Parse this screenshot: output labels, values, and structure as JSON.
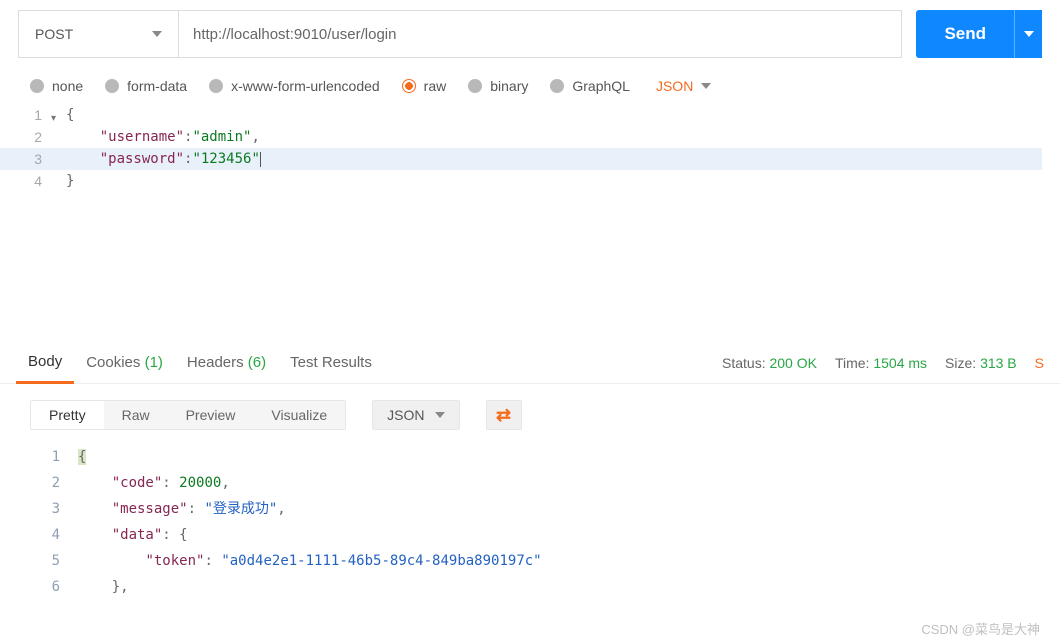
{
  "request": {
    "method": "POST",
    "url": "http://localhost:9010/user/login",
    "send_label": "Send"
  },
  "body_types": {
    "none": "none",
    "form_data": "form-data",
    "urlencoded": "x-www-form-urlencoded",
    "raw": "raw",
    "binary": "binary",
    "graphql": "GraphQL",
    "selected": "raw",
    "format": "JSON"
  },
  "request_body": {
    "lines": [
      "1",
      "2",
      "3",
      "4"
    ],
    "key_username": "\"username\"",
    "val_username": "\"admin\"",
    "key_password": "\"password\"",
    "val_password": "\"123456\""
  },
  "response_tabs": {
    "body": "Body",
    "cookies": "Cookies",
    "cookies_count": "(1)",
    "headers": "Headers",
    "headers_count": "(6)",
    "test_results": "Test Results",
    "status_label": "Status:",
    "status_value": "200 OK",
    "time_label": "Time:",
    "time_value": "1504 ms",
    "size_label": "Size:",
    "size_value": "313 B",
    "save": "S"
  },
  "response_sub": {
    "pretty": "Pretty",
    "raw": "Raw",
    "preview": "Preview",
    "visualize": "Visualize",
    "format": "JSON"
  },
  "response_body": {
    "lines": [
      "1",
      "2",
      "3",
      "4",
      "5",
      "6"
    ],
    "k_code": "\"code\"",
    "v_code": "20000",
    "k_message": "\"message\"",
    "v_message": "\"登录成功\"",
    "k_data": "\"data\"",
    "k_token": "\"token\"",
    "v_token": "\"a0d4e2e1-1111-46b5-89c4-849ba890197c\""
  },
  "watermark": "CSDN @菜鸟是大神"
}
